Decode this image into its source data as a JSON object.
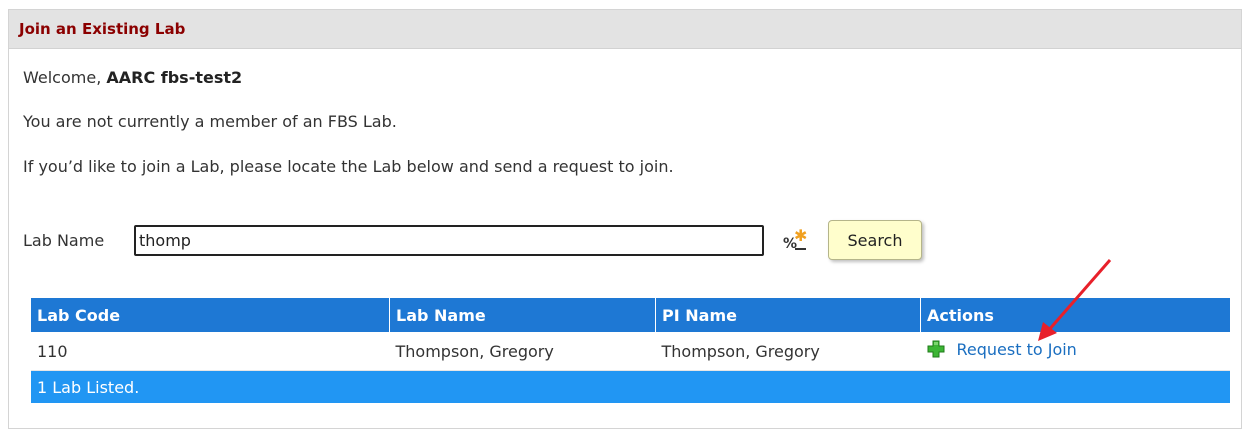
{
  "panel": {
    "title": "Join an Existing Lab"
  },
  "welcome": {
    "prefix": "Welcome, ",
    "user": "AARC fbs-test2"
  },
  "messages": {
    "not_member": "You are not currently a member of an FBS Lab.",
    "instructions": "If you’d like to join a Lab, please locate the Lab below and send a request to join."
  },
  "search": {
    "label": "Lab Name",
    "value": "thomp",
    "wildcard_icon": "percent-asterisk-wildcard-icon",
    "button_label": "Search"
  },
  "table": {
    "headers": [
      "Lab Code",
      "Lab Name",
      "PI Name",
      "Actions"
    ],
    "rows": [
      {
        "lab_code": "110",
        "lab_name": "Thompson, Gregory",
        "pi_name": "Thompson, Gregory",
        "action_label": "Request to Join",
        "action_icon": "green-plus-icon"
      }
    ],
    "footer": "1 Lab Listed."
  },
  "annotation": {
    "arrow_color": "#e8202a",
    "target": "Request to Join"
  },
  "colors": {
    "header_title": "#8b0000",
    "table_header_bg": "#1e78d4",
    "table_footer_bg": "#2196f3",
    "search_button_bg": "#fffecc",
    "link": "#1a6ec0",
    "plus_icon": "#3cb534"
  }
}
